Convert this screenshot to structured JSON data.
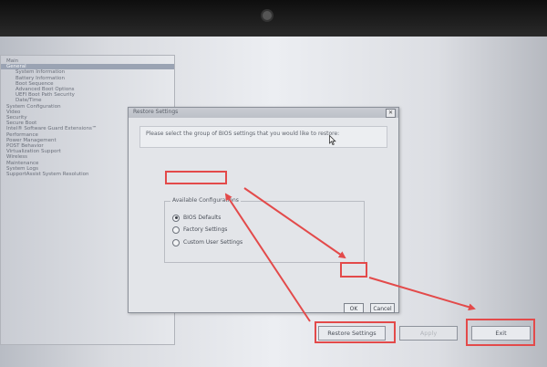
{
  "tree": {
    "items": [
      {
        "label": "Main",
        "level": 1,
        "selected": false
      },
      {
        "label": "General",
        "level": 1,
        "selected": true
      },
      {
        "label": "System Information",
        "level": 2,
        "selected": false
      },
      {
        "label": "Battery Information",
        "level": 2,
        "selected": false
      },
      {
        "label": "Boot Sequence",
        "level": 2,
        "selected": false
      },
      {
        "label": "Advanced Boot Options",
        "level": 2,
        "selected": false
      },
      {
        "label": "UEFI Boot Path Security",
        "level": 2,
        "selected": false
      },
      {
        "label": "Date/Time",
        "level": 2,
        "selected": false
      },
      {
        "label": "System Configuration",
        "level": 1,
        "selected": false
      },
      {
        "label": "Video",
        "level": 1,
        "selected": false
      },
      {
        "label": "Security",
        "level": 1,
        "selected": false
      },
      {
        "label": "Secure Boot",
        "level": 1,
        "selected": false
      },
      {
        "label": "Intel® Software Guard Extensions™",
        "level": 1,
        "selected": false
      },
      {
        "label": "Performance",
        "level": 1,
        "selected": false
      },
      {
        "label": "Power Management",
        "level": 1,
        "selected": false
      },
      {
        "label": "POST Behavior",
        "level": 1,
        "selected": false
      },
      {
        "label": "Virtualization Support",
        "level": 1,
        "selected": false
      },
      {
        "label": "Wireless",
        "level": 1,
        "selected": false
      },
      {
        "label": "Maintenance",
        "level": 1,
        "selected": false
      },
      {
        "label": "System Logs",
        "level": 1,
        "selected": false
      },
      {
        "label": "SupportAssist System Resolution",
        "level": 1,
        "selected": false
      }
    ]
  },
  "dialog": {
    "title": "Restore Settings",
    "close_glyph": "✕",
    "prompt": "Please select the group of BIOS settings that you would like to restore:",
    "group_label": "Available Configurations",
    "options": [
      {
        "label": "BIOS Defaults",
        "selected": true
      },
      {
        "label": "Factory Settings",
        "selected": false
      },
      {
        "label": "Custom User Settings",
        "selected": false
      }
    ],
    "ok_label": "OK",
    "cancel_label": "Cancel"
  },
  "footer": {
    "restore_label": "Restore Settings",
    "apply_label": "Apply",
    "exit_label": "Exit"
  },
  "colors": {
    "highlight": "#e34a4a"
  }
}
